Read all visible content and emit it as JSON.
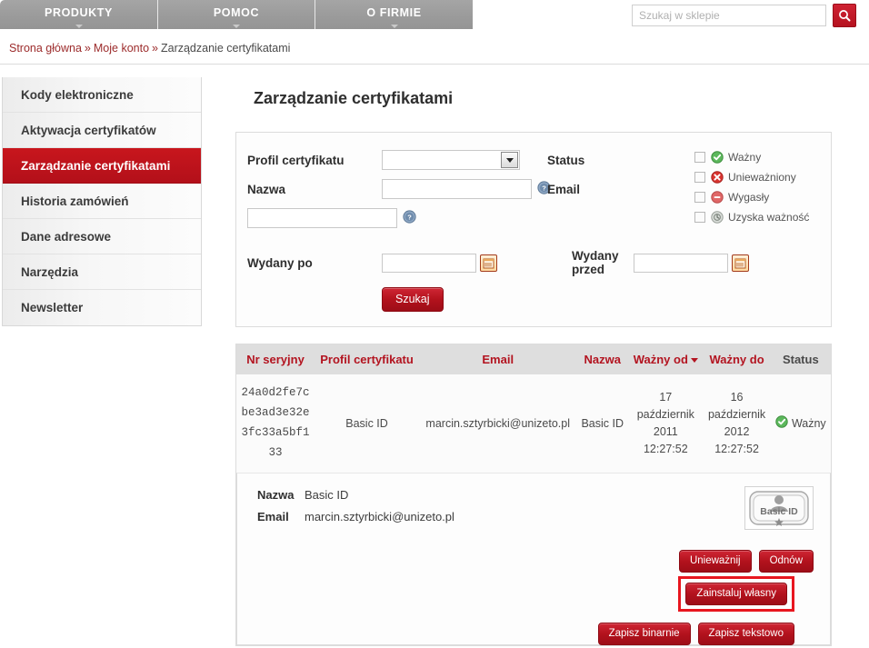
{
  "nav": {
    "tabs": [
      {
        "label": "PRODUKTY"
      },
      {
        "label": "POMOC"
      },
      {
        "label": "O FIRMIE"
      }
    ],
    "search": {
      "placeholder": "Szukaj w sklepie",
      "value": "",
      "button_icon": "search-icon"
    }
  },
  "breadcrumb": {
    "home": "Strona główna",
    "sep1": "»",
    "account": "Moje konto",
    "sep2": "»",
    "current": "Zarządzanie certyfikatami"
  },
  "sidebar": {
    "items": [
      {
        "label": "Kody elektroniczne",
        "active": false
      },
      {
        "label": "Aktywacja certyfikatów",
        "active": false
      },
      {
        "label": "Zarządzanie certyfikatami",
        "active": true
      },
      {
        "label": "Historia zamówień",
        "active": false
      },
      {
        "label": "Dane adresowe",
        "active": false
      },
      {
        "label": "Narzędzia",
        "active": false
      },
      {
        "label": "Newsletter",
        "active": false
      }
    ]
  },
  "main": {
    "title": "Zarządzanie certyfikatami"
  },
  "search_form": {
    "profile_label": "Profil certyfikatu",
    "profile_value": "",
    "name_label": "Nazwa",
    "name_value": "",
    "name_placeholder": "",
    "email_label": "Email",
    "email_value": "",
    "email_placeholder": "",
    "issued_after_label": "Wydany po",
    "issued_after_value": "",
    "issued_before_label": "Wydany przed",
    "issued_before_value": "",
    "submit_label": "Szukaj",
    "status_label": "Status",
    "statuses": [
      {
        "label": "Ważny",
        "icon": "valid-check-icon",
        "checked": false
      },
      {
        "label": "Unieważniony",
        "icon": "revoked-x-icon",
        "checked": false
      },
      {
        "label": "Wygasły",
        "icon": "expired-minus-icon",
        "checked": false
      },
      {
        "label": "Uzyska ważność",
        "icon": "pending-clock-icon",
        "checked": false
      }
    ]
  },
  "table": {
    "columns": [
      {
        "label": "Nr seryjny",
        "sortable": true,
        "sorted": false
      },
      {
        "label": "Profil certyfikatu",
        "sortable": true,
        "sorted": false
      },
      {
        "label": "Email",
        "sortable": true,
        "sorted": false
      },
      {
        "label": "Nazwa",
        "sortable": true,
        "sorted": false
      },
      {
        "label": "Ważny od",
        "sortable": true,
        "sorted": true
      },
      {
        "label": "Ważny do",
        "sortable": true,
        "sorted": false
      },
      {
        "label": "Status",
        "sortable": false,
        "sorted": false
      }
    ],
    "rows": [
      {
        "serial": "24a0d2fe7cbe3ad3e32e3fc33a5bf133",
        "profile": "Basic ID",
        "email": "marcin.sztyrbicki@unizeto.pl",
        "name": "Basic ID",
        "valid_from_day": "17",
        "valid_from_month": "październik",
        "valid_from_year": "2011",
        "valid_from_time": "12:27:52",
        "valid_to_day": "16",
        "valid_to_month": "październik",
        "valid_to_year": "2012",
        "valid_to_time": "12:27:52",
        "status": "Ważny",
        "status_icon": "valid-check-icon"
      }
    ]
  },
  "details": {
    "name_label": "Nazwa",
    "name_value": "Basic ID",
    "email_label": "Email",
    "email_value": "marcin.sztyrbicki@unizeto.pl",
    "badge_text": "Basic ID",
    "buttons": {
      "revoke": "Unieważnij",
      "renew": "Odnów",
      "install": "Zainstaluj własny",
      "save_binary": "Zapisz binarnie",
      "save_text": "Zapisz tekstowo"
    }
  },
  "colors": {
    "brand_red": "#b3121d",
    "nav_gray": "#9b9b9b",
    "highlight": "#e8161f",
    "status_valid": "#4caf50",
    "status_revoked": "#d32f2f",
    "status_expired": "#e05050",
    "status_pending": "#9e9e9e"
  }
}
